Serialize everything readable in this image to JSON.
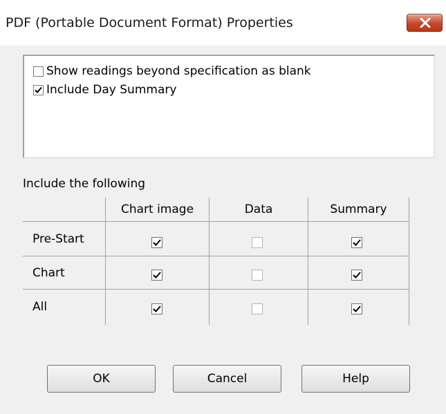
{
  "window": {
    "title": "PDF (Portable Document Format) Properties",
    "close_icon": "close-x-icon"
  },
  "options": [
    {
      "label": "Show readings beyond specification as blank",
      "checked": false
    },
    {
      "label": "Include Day Summary",
      "checked": true
    }
  ],
  "table": {
    "section_label": "Include the following",
    "columns": [
      "Chart image",
      "Data",
      "Summary"
    ],
    "rows": [
      {
        "label": "Pre-Start",
        "chart_image": true,
        "data": false,
        "summary": true
      },
      {
        "label": "Chart",
        "chart_image": true,
        "data": false,
        "summary": true
      },
      {
        "label": "All",
        "chart_image": true,
        "data": false,
        "summary": true
      }
    ]
  },
  "buttons": {
    "ok": "OK",
    "cancel": "Cancel",
    "help": "Help"
  },
  "colors": {
    "dialog_bg": "#f0f0f0",
    "close_button": "#c7452a",
    "border": "#a0a0a0"
  }
}
